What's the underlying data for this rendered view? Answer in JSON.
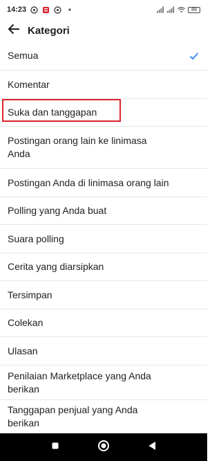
{
  "status_bar": {
    "time": "14:23",
    "battery": "89",
    "icons": [
      "browser-icon",
      "notification-icon",
      "browser-icon",
      "dot-icon",
      "signal-icon",
      "signal-icon",
      "wifi-icon",
      "battery-icon"
    ]
  },
  "app_bar": {
    "title": "Kategori",
    "back_icon": "back-arrow-icon"
  },
  "categories": [
    {
      "label": "Semua",
      "selected": true
    },
    {
      "label": "Komentar",
      "selected": false
    },
    {
      "label": "Suka dan tanggapan",
      "selected": false,
      "highlighted": true
    },
    {
      "label": "Postingan orang lain ke linimasa Anda",
      "selected": false
    },
    {
      "label": "Postingan Anda di linimasa orang lain",
      "selected": false
    },
    {
      "label": "Polling yang Anda buat",
      "selected": false
    },
    {
      "label": "Suara polling",
      "selected": false
    },
    {
      "label": "Cerita yang diarsipkan",
      "selected": false
    },
    {
      "label": "Tersimpan",
      "selected": false
    },
    {
      "label": "Colekan",
      "selected": false
    },
    {
      "label": "Ulasan",
      "selected": false
    },
    {
      "label": "Penilaian Marketplace yang Anda berikan",
      "selected": false
    },
    {
      "label": "Tanggapan penjual yang Anda berikan",
      "selected": false
    }
  ],
  "colors": {
    "check": "#1877f2",
    "highlight": "#d9242b",
    "nav_bar": "#000000"
  },
  "nav_bar": {
    "buttons": [
      "recents-square-icon",
      "home-circle-icon",
      "back-triangle-icon"
    ]
  }
}
